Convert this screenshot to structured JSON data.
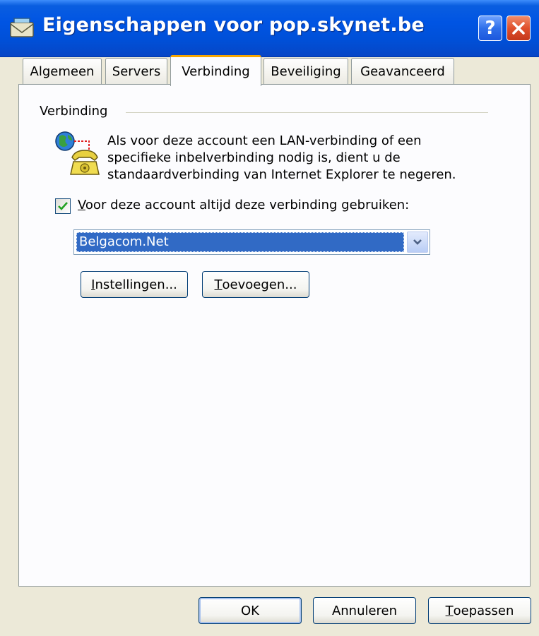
{
  "window": {
    "title": "Eigenschappen voor pop.skynet.be",
    "help_label": "?",
    "close_label": "✕"
  },
  "tabs": [
    {
      "label": "Algemeen",
      "active": false
    },
    {
      "label": "Servers",
      "active": false
    },
    {
      "label": "Verbinding",
      "active": true
    },
    {
      "label": "Beveiliging",
      "active": false
    },
    {
      "label": "Geavanceerd",
      "active": false
    }
  ],
  "connection": {
    "group_label": "Verbinding",
    "description": "Als voor deze account een LAN-verbinding of een specifieke inbelverbinding nodig is, dient u de standaardverbinding van Internet Explorer te negeren.",
    "checkbox_label_first": "V",
    "checkbox_label_rest": "oor deze account altijd deze verbinding gebruiken:",
    "checkbox_checked": true,
    "selected_connection": "Belgacom.Net",
    "settings_button_first": "I",
    "settings_button_rest": "nstellingen...",
    "add_button_first": "T",
    "add_button_rest": "oevoegen...",
    "icon": "globe-phone-icon"
  },
  "footer": {
    "ok_label": "OK",
    "cancel_label": "Annuleren",
    "apply_first": "T",
    "apply_rest": "oepassen"
  },
  "colors": {
    "titlebar": "#0054e3",
    "selection": "#316ac5",
    "tab_highlight": "#f7a600",
    "window_bg": "#ece9d8"
  }
}
